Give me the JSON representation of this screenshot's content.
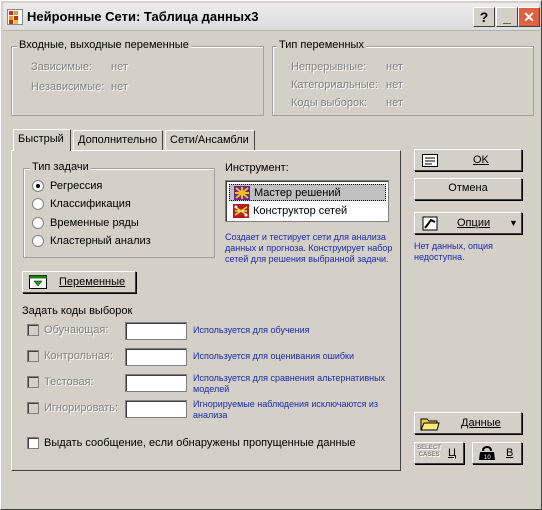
{
  "window": {
    "title": "Нейронные Сети: Таблица данных3",
    "help_btn": "?",
    "min_btn": "_",
    "close_btn": "✕"
  },
  "io_vars": {
    "legend": "Входные, выходные переменные",
    "dependent_label": "Зависимые:",
    "dependent_value": "нет",
    "independent_label": "Независимые:",
    "independent_value": "нет"
  },
  "var_types": {
    "legend": "Тип переменных",
    "continuous_label": "Непрерывные:",
    "continuous_value": "нет",
    "categorical_label": "Категориальные:",
    "categorical_value": "нет",
    "sample_label": "Коды выборок:",
    "sample_value": "нет"
  },
  "tabs": [
    "Быстрый",
    "Дополнительно",
    "Сети/Ансамбли"
  ],
  "task": {
    "legend": "Тип задачи",
    "options": [
      "Регрессия",
      "Классификация",
      "Временные ряды",
      "Кластерный анализ"
    ],
    "selected": "Регрессия"
  },
  "tool": {
    "label": "Инструмент:",
    "items": [
      "Мастер решений",
      "Конструктор сетей"
    ],
    "selected": "Мастер решений",
    "description": "Создает и тестирует сети для анализа данных и прогноза. Конструирует набор сетей для решения выбранной задачи."
  },
  "variables_button": "Переменные",
  "sample_codes": {
    "label": "Задать коды выборок",
    "rows": [
      {
        "label": "Обучающая:",
        "note": "Используется для обучения"
      },
      {
        "label": "Контрольная:",
        "note": "Используется для оценивания ошибки"
      },
      {
        "label": "Тестовая:",
        "note": "Используется для сравнения альтернативных моделей"
      },
      {
        "label": "Игнорировать:",
        "note": "Игнорируемые наблюдения исключаются из анализа"
      }
    ]
  },
  "missing_msg": "Выдать сообщение, если обнаружены пропущенные данные",
  "right": {
    "ok": "OK",
    "cancel": "Отмена",
    "options": "Опции",
    "options_note": "Нет данных, опция недоступна.",
    "data": "Данные",
    "u_btn": "Ц",
    "v_btn": "В",
    "select_cases": "SELECT CASES"
  }
}
